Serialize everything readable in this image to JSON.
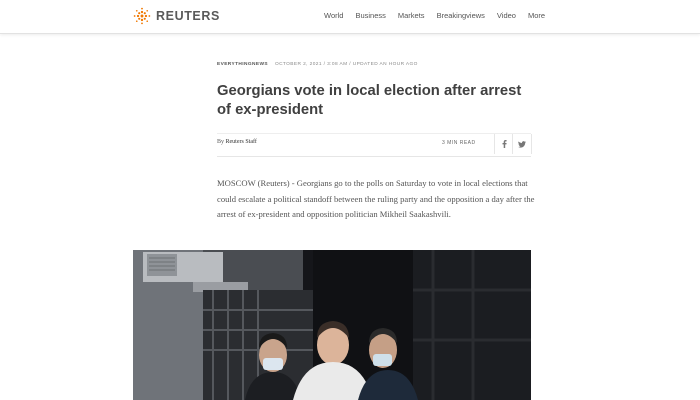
{
  "header": {
    "brand": "REUTERS",
    "nav": [
      "World",
      "Business",
      "Markets",
      "Breakingviews",
      "Video",
      "More"
    ]
  },
  "article": {
    "category": "EVERYTHINGNEWS",
    "dateline": "OCTOBER 2, 2021 / 3:08 AM / UPDATED AN HOUR AGO",
    "headline": "Georgians vote in local election after arrest of ex-president",
    "byline_prefix": "By",
    "author": "Reuters Staff",
    "read_time": "3 MIN READ",
    "body": "MOSCOW (Reuters) - Georgians go to the polls on Saturday to vote in local elections that could escalate a political standoff between the ruling party and the opposition a day after the arrest of ex-president and opposition politician Mikheil Saakashvili."
  },
  "colors": {
    "brand_orange": "#f07800",
    "text": "#404040",
    "photo_bg": "#15161a"
  },
  "icons": [
    "reuters-logo-icon",
    "facebook-icon",
    "twitter-icon"
  ]
}
